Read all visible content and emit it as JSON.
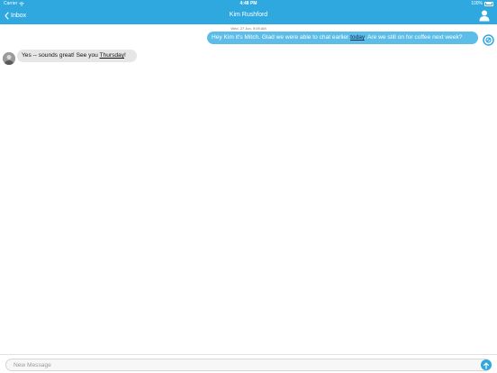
{
  "status_bar": {
    "carrier": "Carrier",
    "time": "4:48 PM",
    "battery": "100%"
  },
  "nav": {
    "back_label": "Inbox",
    "title": "Kim Rushford"
  },
  "conversation": {
    "timestamp": "Wed, 27 Jun, 9:09 AM",
    "messages": [
      {
        "direction": "outgoing",
        "text_before": "Hey Kim it's Mitch. Glad we were able to chat earlier ",
        "link": "today",
        "text_after": ". Are we still on for coffee next week?"
      },
      {
        "direction": "incoming",
        "text_before": "Yes -- sounds great! See you ",
        "link": "Thursday",
        "text_after": "!"
      }
    ]
  },
  "composer": {
    "placeholder": "New Message"
  },
  "colors": {
    "accent": "#2fa8e0",
    "outgoing_bubble": "#5cbde9",
    "incoming_bubble": "#e6e6e6"
  },
  "icons": {
    "back": "chevron-left-icon",
    "profile": "person-icon",
    "status": "circle-slash-icon",
    "send": "arrow-up-icon",
    "wifi": "wifi-icon",
    "battery": "battery-icon"
  }
}
